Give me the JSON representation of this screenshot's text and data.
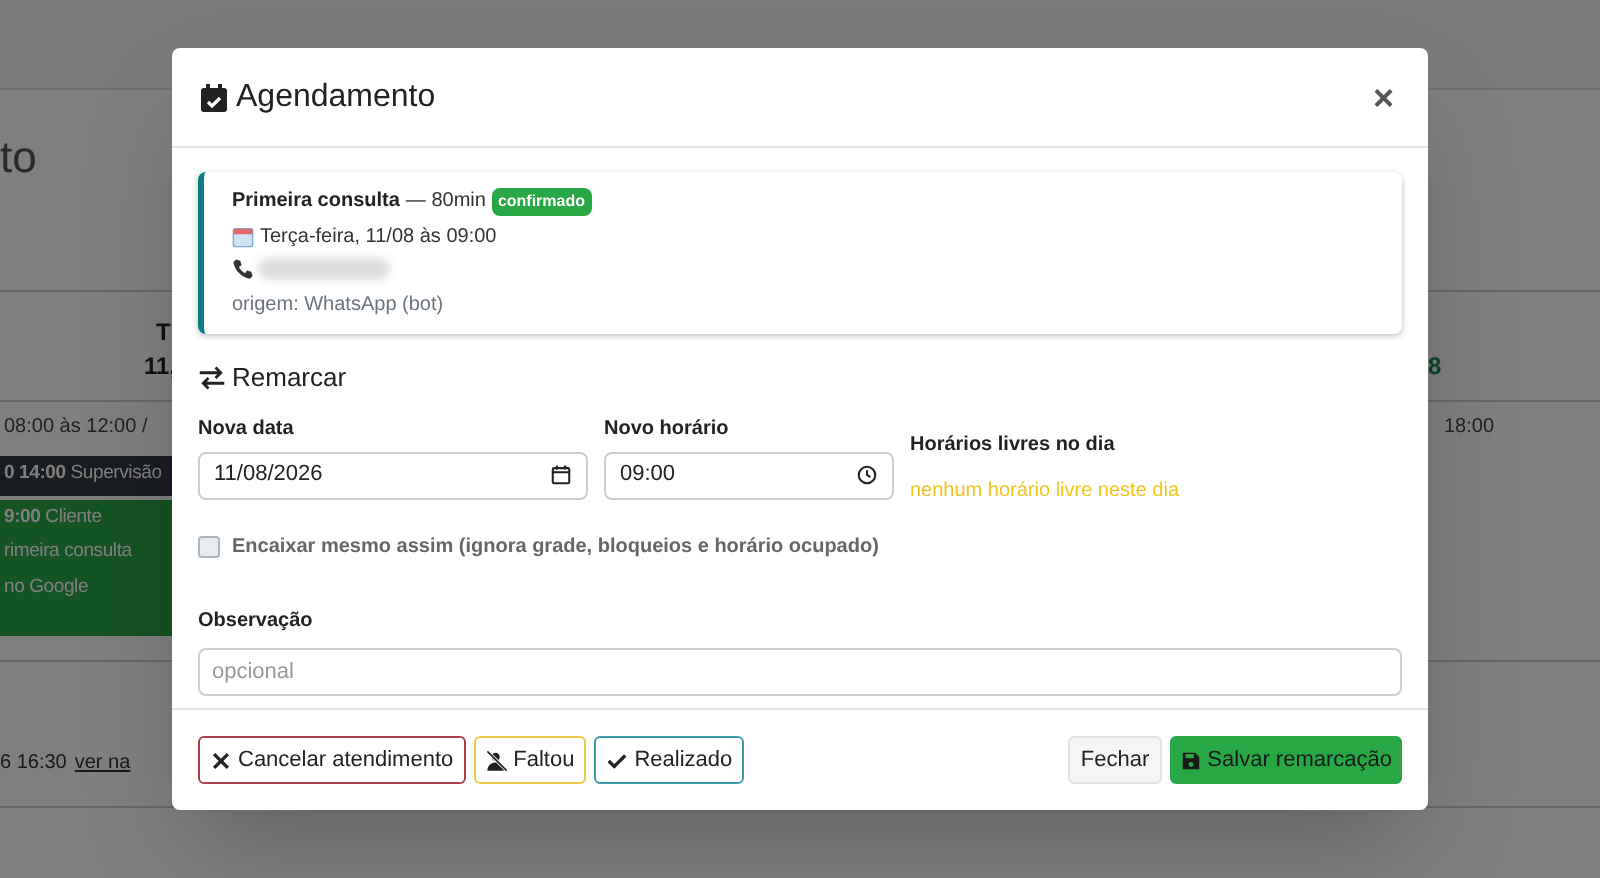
{
  "background": {
    "heading": "to",
    "day_header": {
      "weekday": "T",
      "date": "11,"
    },
    "right_day": "8",
    "hours_left": "08:00 às 12:00 /",
    "hours_right": "18:00",
    "events": [
      {
        "kind": "block",
        "time": "0 14:00",
        "title": "Supervisão"
      },
      {
        "kind": "appointment",
        "time": "9:00",
        "title": "Cliente",
        "lines": [
          "rimeira consulta",
          "no Google"
        ]
      }
    ],
    "footer": {
      "text": "6 16:30",
      "link": "ver na"
    }
  },
  "modal": {
    "title": "Agendamento",
    "close": "×",
    "summary": {
      "service": "Primeira consulta",
      "duration": "— 80min",
      "status": "confirmado",
      "date": "Terça-feira, 11/08 às 09:00",
      "origin": "origem: WhatsApp (bot)"
    },
    "section": "Remarcar",
    "date_field": {
      "label": "Nova data",
      "value": "11/08/2026"
    },
    "time_field": {
      "label": "Novo horário",
      "value": "09:00"
    },
    "free_slots": {
      "label": "Horários livres no dia",
      "message": "nenhum horário livre neste dia"
    },
    "force_fit": {
      "label": "Encaixar mesmo assim (ignora grade, bloqueios e horário ocupado)",
      "checked": false
    },
    "observation": {
      "label": "Observação",
      "placeholder": "opcional"
    },
    "actions_left": [
      {
        "kind": "cancel",
        "label": "Cancelar atendimento"
      },
      {
        "kind": "no_show",
        "label": "Faltou"
      },
      {
        "kind": "done",
        "label": "Realizado"
      }
    ],
    "actions_right": [
      {
        "kind": "close",
        "label": "Fechar"
      },
      {
        "kind": "save",
        "label": "Salvar remarcação"
      }
    ]
  }
}
